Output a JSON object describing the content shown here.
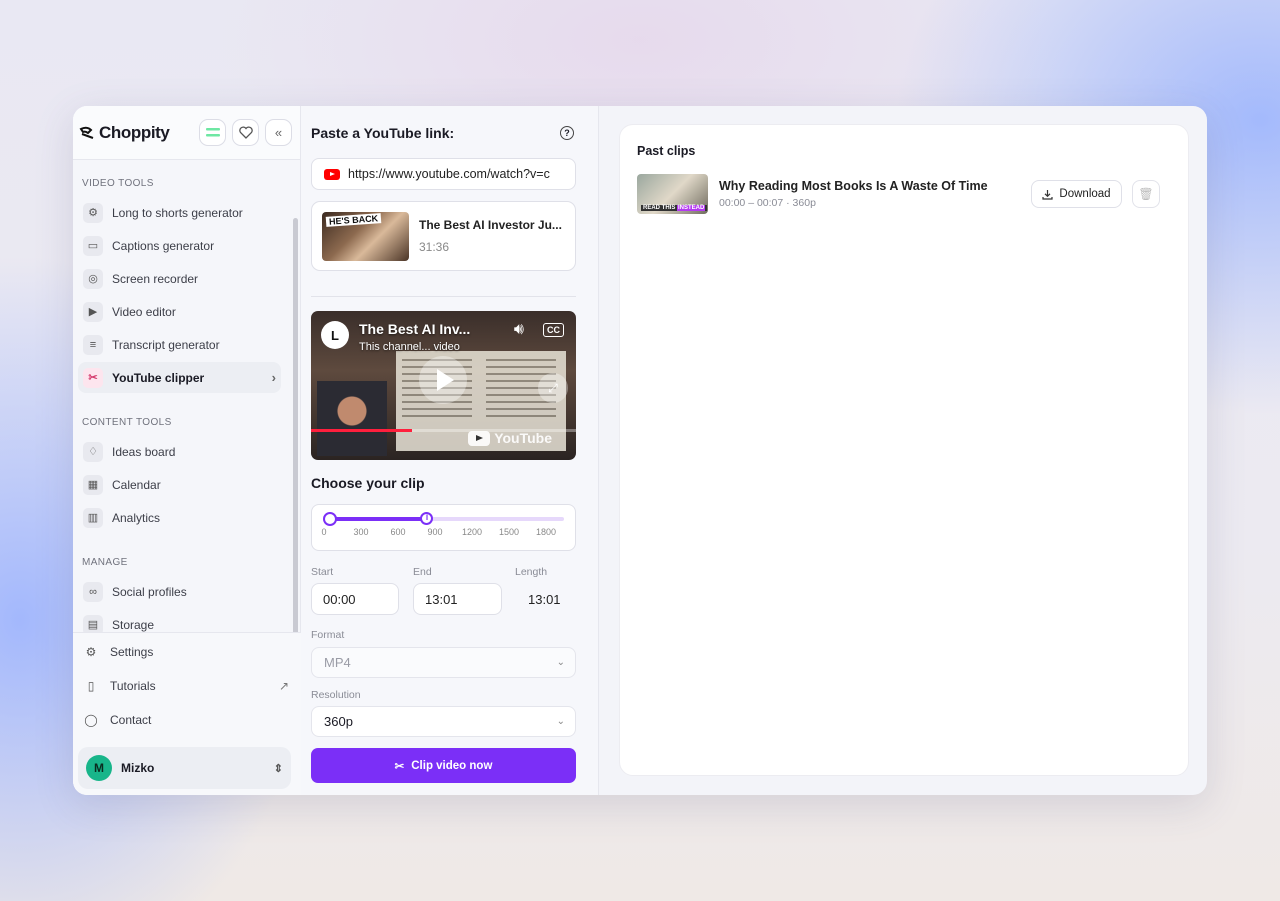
{
  "app": {
    "name": "Choppity"
  },
  "sidebar": {
    "sections": [
      {
        "title": "VIDEO TOOLS",
        "items": [
          {
            "label": "Long to shorts generator",
            "icon": "robot-icon"
          },
          {
            "label": "Captions generator",
            "icon": "captions-icon"
          },
          {
            "label": "Screen recorder",
            "icon": "screen-record-icon"
          },
          {
            "label": "Video editor",
            "icon": "video-editor-icon"
          },
          {
            "label": "Transcript generator",
            "icon": "transcript-icon"
          },
          {
            "label": "YouTube clipper",
            "icon": "scissors-icon",
            "active": true
          }
        ]
      },
      {
        "title": "CONTENT TOOLS",
        "items": [
          {
            "label": "Ideas board",
            "icon": "lightbulb-icon"
          },
          {
            "label": "Calendar",
            "icon": "calendar-icon"
          },
          {
            "label": "Analytics",
            "icon": "chart-icon"
          }
        ]
      },
      {
        "title": "MANAGE",
        "items": [
          {
            "label": "Social profiles",
            "icon": "link-icon"
          },
          {
            "label": "Storage",
            "icon": "storage-icon"
          }
        ]
      }
    ],
    "bottom": [
      {
        "label": "Settings",
        "icon": "gear-icon"
      },
      {
        "label": "Tutorials",
        "icon": "book-icon"
      },
      {
        "label": "Contact",
        "icon": "chat-icon"
      }
    ],
    "user": {
      "initial": "M",
      "name": "Mizko"
    }
  },
  "clipper": {
    "heading": "Paste a YouTube link:",
    "url": "https://www.youtube.com/watch?v=c",
    "video": {
      "title": "The Best AI Investor Ju...",
      "duration": "31:36",
      "thumb_tag": "HE'S BACK"
    },
    "player": {
      "logo": "L",
      "title": "The Best AI Inv...",
      "subtitle": "This channel... video",
      "brand": "YouTube",
      "progress": 0.38
    },
    "choose_heading": "Choose your clip",
    "slider": {
      "ticks": [
        "0",
        "300",
        "600",
        "900",
        "1200",
        "1500",
        "1800"
      ],
      "min": 0,
      "max": 1896,
      "start": 0,
      "end": 781
    },
    "start_label": "Start",
    "end_label": "End",
    "length_label": "Length",
    "start_value": "00:00",
    "end_value": "13:01",
    "length_value": "13:01",
    "format_label": "Format",
    "format_value": "MP4",
    "resolution_label": "Resolution",
    "resolution_value": "360p",
    "clip_button": "Clip video now"
  },
  "past_clips": {
    "heading": "Past clips",
    "items": [
      {
        "title": "Why Reading Most Books Is A Waste Of Time",
        "meta": "00:00 – 00:07 · 360p",
        "thumb_text": "READ THIS",
        "thumb_highlight": "INSTEAD"
      }
    ],
    "download_label": "Download"
  },
  "colors": {
    "accent": "#7b2ff7",
    "youtube_red": "#ff0000",
    "avatar": "#18b58a"
  }
}
